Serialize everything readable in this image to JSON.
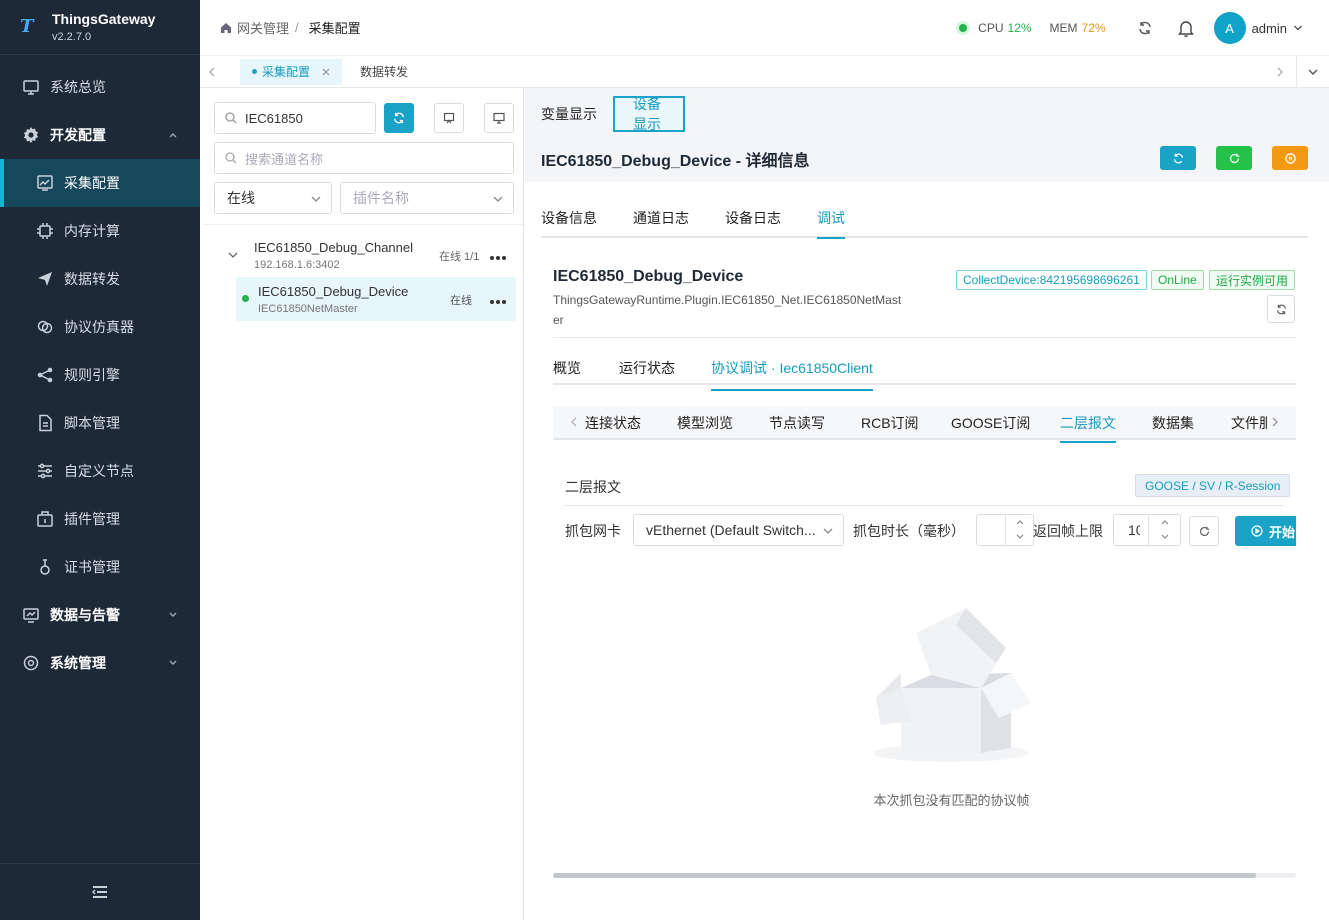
{
  "app": {
    "name": "ThingsGateway",
    "version": "v2.2.7.0"
  },
  "sidebar": {
    "items": [
      {
        "label": "系统总览",
        "icon": "monitor-icon"
      },
      {
        "label": "开发配置",
        "icon": "gear-icon"
      },
      {
        "label": "采集配置",
        "icon": "chart-icon"
      },
      {
        "label": "内存计算",
        "icon": "cpu-icon"
      },
      {
        "label": "数据转发",
        "icon": "send-icon"
      },
      {
        "label": "协议仿真器",
        "icon": "link-icon"
      },
      {
        "label": "规则引擎",
        "icon": "share-icon"
      },
      {
        "label": "脚本管理",
        "icon": "file-icon"
      },
      {
        "label": "自定义节点",
        "icon": "sliders-icon"
      },
      {
        "label": "插件管理",
        "icon": "plugin-icon"
      },
      {
        "label": "证书管理",
        "icon": "cert-icon"
      },
      {
        "label": "数据与告警",
        "icon": "monitor-icon"
      },
      {
        "label": "系统管理",
        "icon": "gear-icon"
      }
    ]
  },
  "header": {
    "breadcrumb_root": "网关管理",
    "breadcrumb_sep": "/",
    "breadcrumb_current": "采集配置",
    "cpu_label": "CPU",
    "cpu_value": "12%",
    "mem_label": "MEM",
    "mem_value": "72%",
    "avatar_letter": "A",
    "user": "admin",
    "colors": {
      "cpu": "#22b14c",
      "mem": "#e39a1c",
      "accent": "#1aa3c7"
    }
  },
  "tabs": [
    {
      "label": "采集配置"
    },
    {
      "label": "数据转发"
    }
  ],
  "left": {
    "search_value": "IEC61850",
    "channel_search_placeholder": "搜索通道名称",
    "status_filter": "在线",
    "plugin_placeholder": "插件名称",
    "channel": {
      "name": "IEC61850_Debug_Channel",
      "addr": "192.168.1.6:3402",
      "status": "在线 1/1"
    },
    "device": {
      "name": "IEC61850_Debug_Device",
      "plugin": "IEC61850NetMaster",
      "status": "在线"
    }
  },
  "main": {
    "view_tabs": [
      "变量显示",
      "设备显示"
    ],
    "title": "IEC61850_Debug_Device - 详细信息",
    "tabs1": [
      "设备信息",
      "通道日志",
      "设备日志",
      "调试"
    ],
    "device_name": "IEC61850_Debug_Device",
    "device_class_1": "ThingsGatewayRuntime.Plugin.IEC61850_Net.IEC61850NetMast",
    "device_class_2": "er",
    "badges": [
      "CollectDevice:842195698696261",
      "OnLine",
      "运行实例可用"
    ],
    "tabs2": [
      "概览",
      "运行状态",
      "协议调试 · Iec61850Client"
    ],
    "tabs3": [
      "连接状态",
      "模型浏览",
      "节点读写",
      "RCB订阅",
      "GOOSE订阅",
      "二层报文",
      "数据集",
      "文件服"
    ],
    "section_title": "二层报文",
    "section_tag": "GOOSE / SV / R-Session",
    "nic_label": "抓包网卡",
    "nic_value": "vEthernet (Default Switch...",
    "duration_label": "抓包时长（毫秒）",
    "limit_label": "返回帧上限",
    "limit_value": "10",
    "start_button": "开始",
    "empty_text": "本次抓包没有匹配的协议帧"
  }
}
